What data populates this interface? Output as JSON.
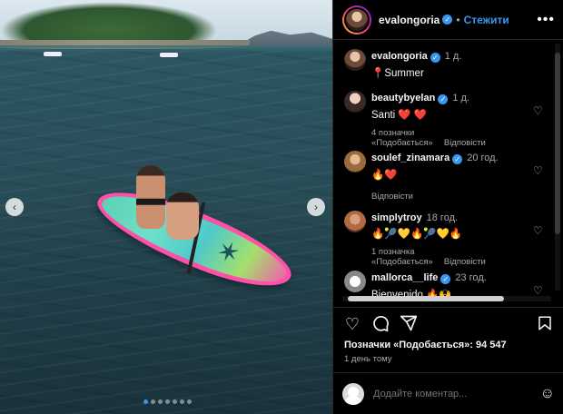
{
  "post": {
    "username": "evalongoria",
    "follow_label": "Стежити",
    "more_icon": "more-horizontal-icon",
    "carousel": {
      "slides": 7,
      "active": 1
    }
  },
  "caption": {
    "username": "evalongoria",
    "time": "1 д.",
    "text": "📍Summer"
  },
  "comments": [
    {
      "username": "beautybyelan",
      "time": "1 д.",
      "text": "Santi ❤️ ❤️",
      "likes": "4 позначки «Подобається»",
      "reply": "Відповісти",
      "verified": true
    },
    {
      "username": "soulef_zinamara",
      "time": "20 год.",
      "text": "🔥❤️",
      "likes": "",
      "reply": "Відповісти",
      "verified": true
    },
    {
      "username": "simplytroy",
      "time": "18 год.",
      "text": "🔥🎾💛🔥🎾💛🔥",
      "likes": "1 позначка «Подобається»",
      "reply": "Відповісти",
      "verified": false
    },
    {
      "username": "mallorca__life",
      "time": "23 год.",
      "text": "Bienvenido 🔥🙌",
      "likes": "",
      "reply": "",
      "verified": true
    }
  ],
  "likes_text": "Позначки «Подобається»: 94 547",
  "posted": "1 день тому",
  "add_comment_placeholder": "Додайте коментар...",
  "colors": {
    "accent": "#3897f0",
    "background": "#000000",
    "muted": "#a8a8a8"
  }
}
